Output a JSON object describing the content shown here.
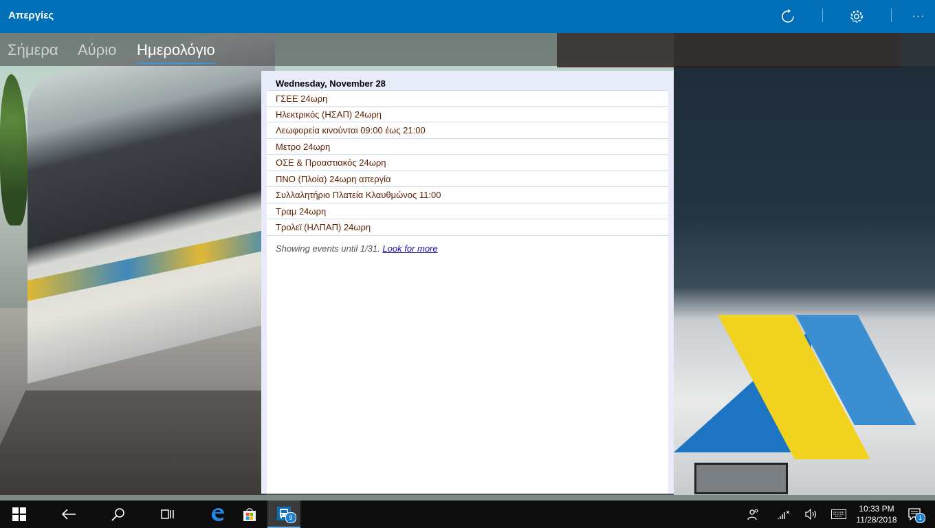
{
  "app": {
    "title": "Απεργίες"
  },
  "toolbar": {
    "refresh_icon": "refresh-icon",
    "settings_icon": "gear-icon",
    "more_label": "···"
  },
  "tabs": [
    {
      "label": "Σήμερα",
      "active": false
    },
    {
      "label": "Αύριο",
      "active": false
    },
    {
      "label": "Ημερολόγιο",
      "active": true
    }
  ],
  "calendar": {
    "date_header": "Wednesday, November 28",
    "events": [
      "ΓΣΕΕ 24ωρη",
      "Ηλεκτρικός (ΗΣΑΠ) 24ωρη",
      "Λεωφορεία κινούνται 09:00 έως 21:00",
      "Μετρο 24ωρη",
      "ΟΣΕ & Προαστιακός 24ωρη",
      "ΠΝΟ (Πλοία) 24ωρη απεργία",
      "Συλλαλητήριο Πλατεία Κλαυθμώνος 11:00",
      "Τραμ 24ωρη",
      "Τρολεϊ (ΗΛΠΑΠ) 24ωρη"
    ],
    "footer_text": "Showing events until 1/31.",
    "footer_link": "Look for more"
  },
  "taskbar": {
    "app_badge": "9",
    "time": "10:33 PM",
    "date": "11/28/2018",
    "notification_count": "1"
  },
  "colors": {
    "titlebar": "#006fb7",
    "tab_underline": "#2f9be3",
    "event_text": "#5b1f00",
    "link": "#1a0dab"
  }
}
